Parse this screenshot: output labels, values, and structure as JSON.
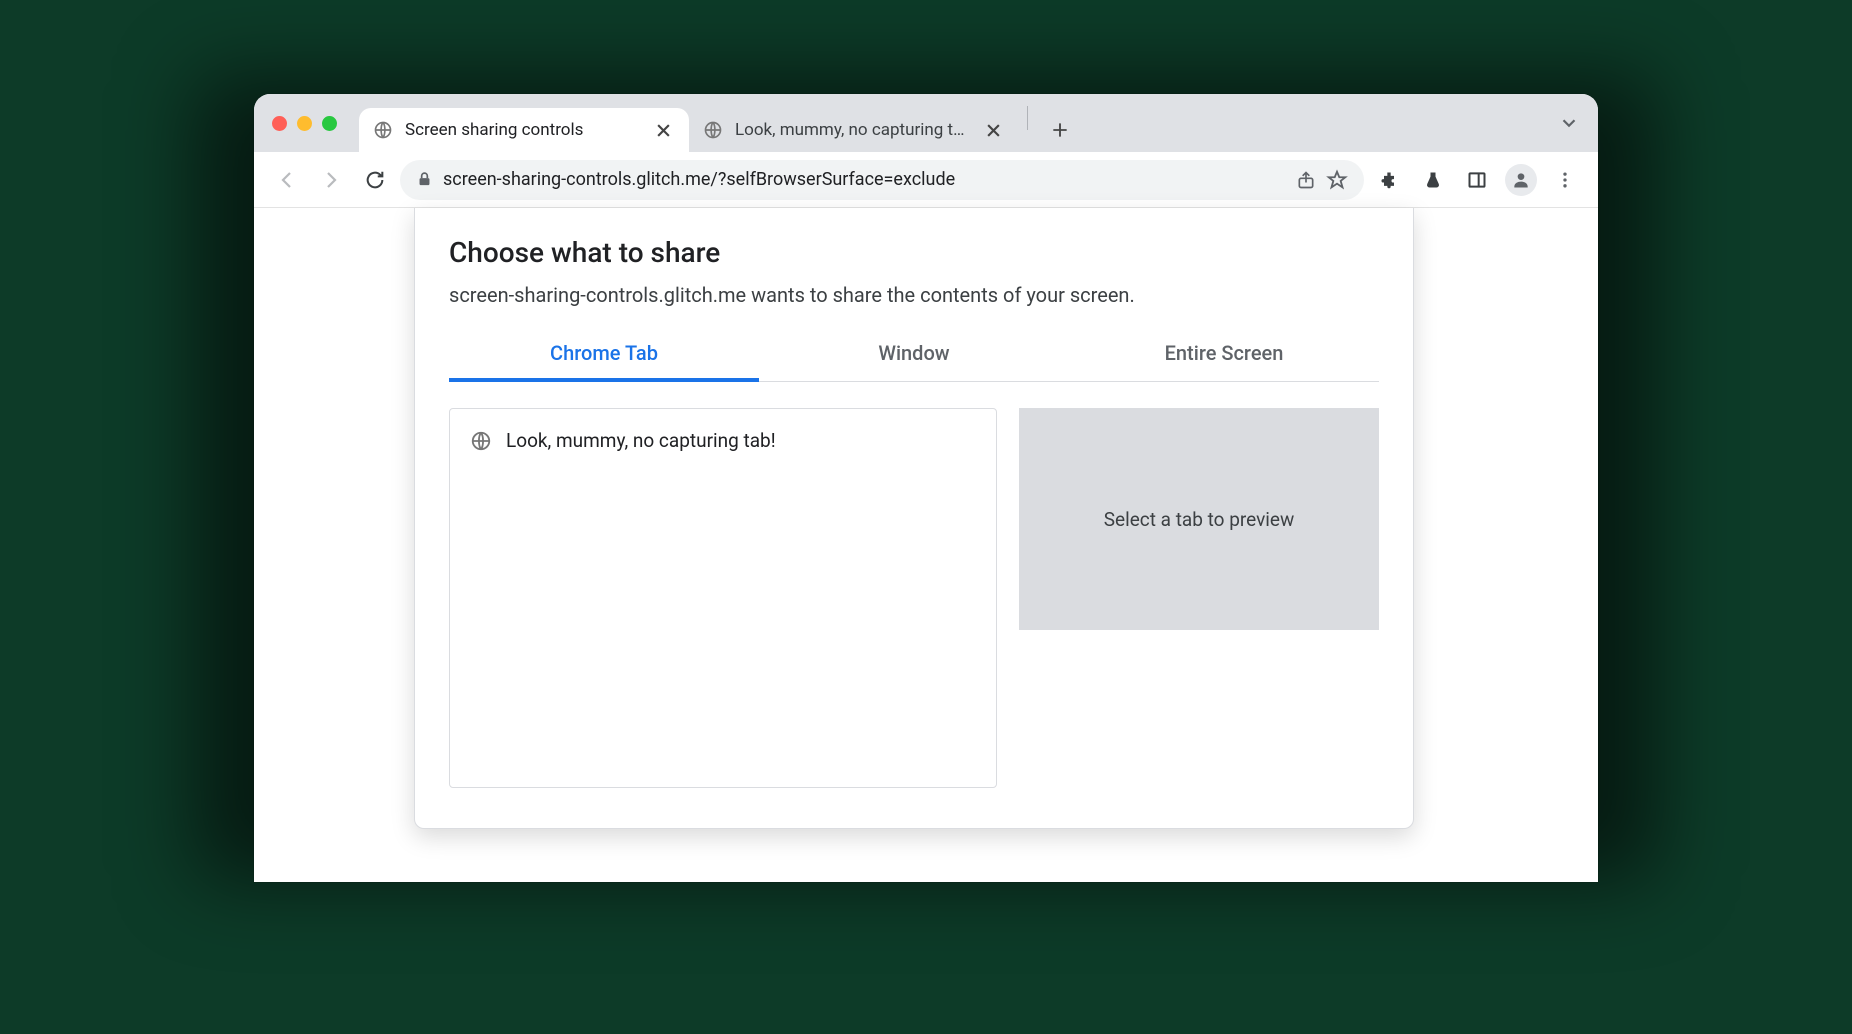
{
  "tabs": [
    {
      "title": "Screen sharing controls"
    },
    {
      "title": "Look, mummy, no capturing tab"
    }
  ],
  "url": "screen-sharing-controls.glitch.me/?selfBrowserSurface=exclude",
  "dialog": {
    "title": "Choose what to share",
    "subtitle": "screen-sharing-controls.glitch.me wants to share the contents of your screen.",
    "tabs": [
      "Chrome Tab",
      "Window",
      "Entire Screen"
    ],
    "activeTab": 0,
    "listItems": [
      {
        "title": "Look, mummy, no capturing tab!"
      }
    ],
    "previewPlaceholder": "Select a tab to preview"
  }
}
